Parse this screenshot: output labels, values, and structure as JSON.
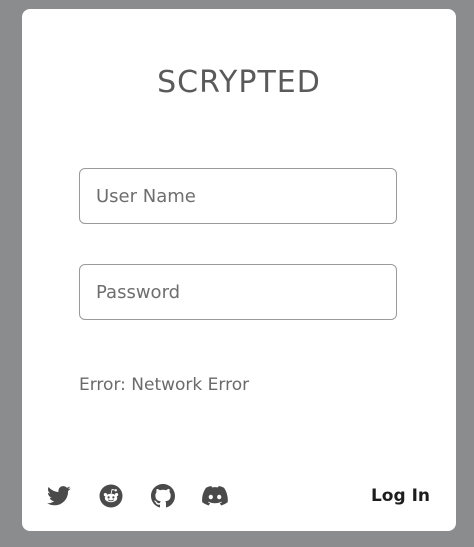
{
  "login": {
    "title": "SCRYPTED",
    "username": {
      "placeholder": "User Name",
      "value": ""
    },
    "password": {
      "placeholder": "Password",
      "value": ""
    },
    "error_message": "Error: Network Error",
    "login_button": "Log In"
  },
  "social_links": [
    {
      "icon": "twitter-icon"
    },
    {
      "icon": "reddit-icon"
    },
    {
      "icon": "github-icon"
    },
    {
      "icon": "discord-icon"
    }
  ],
  "colors": {
    "backdrop": "#8b8c8e",
    "card": "#ffffff",
    "title": "#5a5a5a",
    "field_border": "#9a9a9a",
    "icon": "#4a4a4a",
    "button_text": "#1d1d1d"
  }
}
